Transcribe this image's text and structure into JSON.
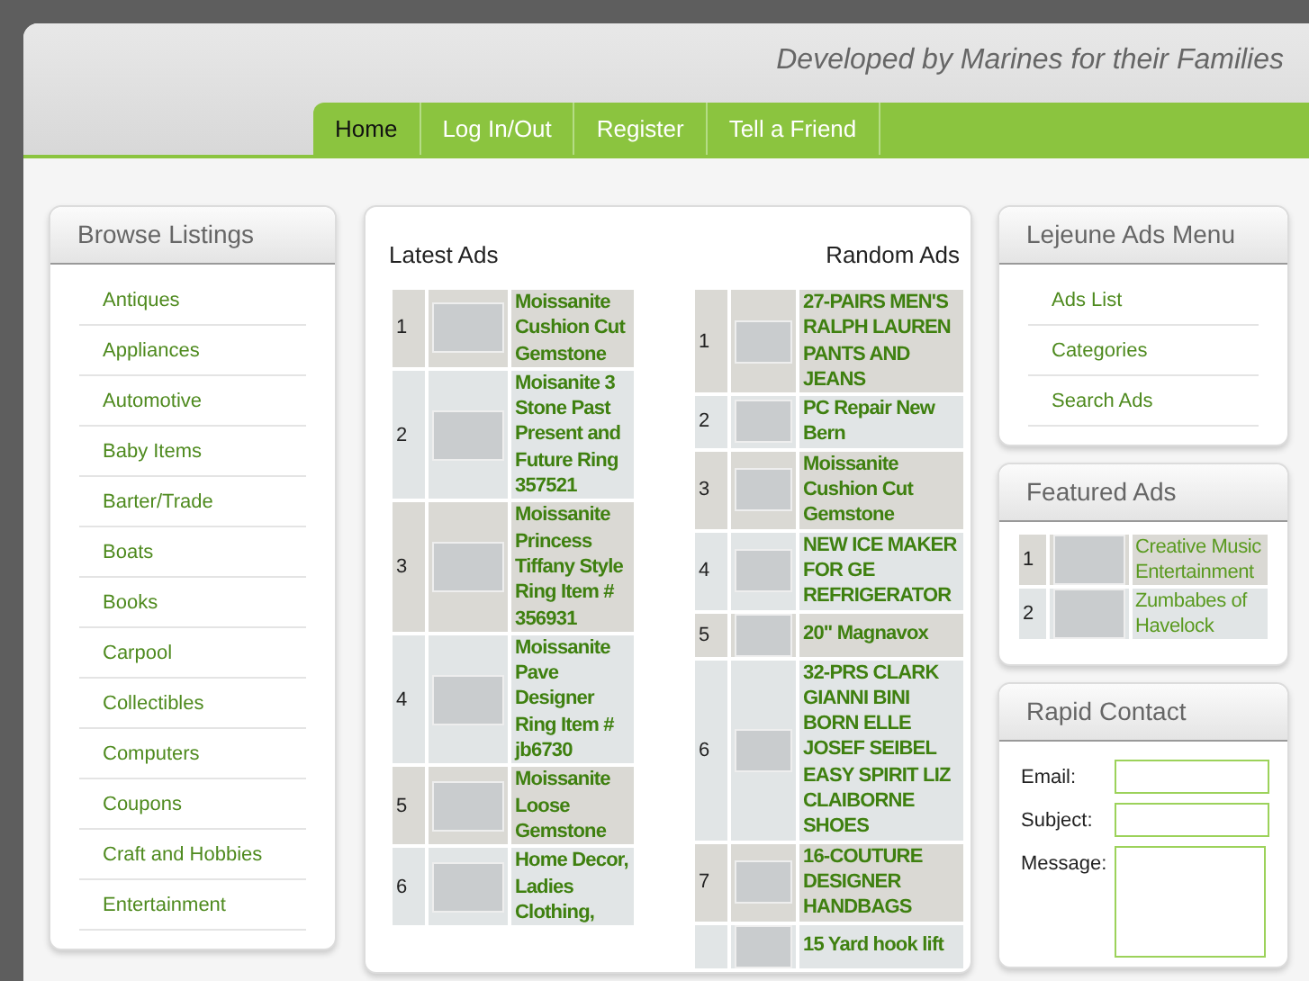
{
  "header": {
    "tagline": "Developed by Marines for their Families"
  },
  "nav": [
    {
      "label": "Home",
      "selected": true
    },
    {
      "label": "Log In/Out",
      "selected": false
    },
    {
      "label": "Register",
      "selected": false
    },
    {
      "label": "Tell a Friend",
      "selected": false
    }
  ],
  "browse_listings": {
    "title": "Browse Listings",
    "items": [
      "Antiques",
      "Appliances",
      "Automotive",
      "Baby Items",
      "Barter/Trade",
      "Boats",
      "Books",
      "Carpool",
      "Collectibles",
      "Computers",
      "Coupons",
      "Craft and Hobbies",
      "Entertainment"
    ]
  },
  "latest_ads": {
    "title": "Latest Ads",
    "rows": [
      {
        "number": "1",
        "title": "Moissanite Cushion Cut Gemstone"
      },
      {
        "number": "2",
        "title": "Moisanite 3 Stone Past Present and Future Ring 357521"
      },
      {
        "number": "3",
        "title": "Moissanite Princess Tiffany Style Ring Item # 356931"
      },
      {
        "number": "4",
        "title": "Moissanite Pave Designer Ring Item # jb6730"
      },
      {
        "number": "5",
        "title": "Moissanite Loose Gemstone"
      },
      {
        "number": "6",
        "title": "Home Decor, Ladies Clothing,"
      }
    ]
  },
  "random_ads": {
    "title": "Random Ads",
    "rows": [
      {
        "number": "1",
        "title": "27-PAIRS MEN'S RALPH LAUREN PANTS AND JEANS"
      },
      {
        "number": "2",
        "title": "PC Repair New Bern"
      },
      {
        "number": "3",
        "title": "Moissanite Cushion Cut Gemstone"
      },
      {
        "number": "4",
        "title": "NEW ICE MAKER FOR GE REFRIGERATOR"
      },
      {
        "number": "5",
        "title": "20\" Magnavox"
      },
      {
        "number": "6",
        "title": "32-PRS CLARK GIANNI BINI BORN ELLE JOSEF SEIBEL EASY SPIRIT LIZ CLAIBORNE SHOES"
      },
      {
        "number": "7",
        "title": "16-COUTURE DESIGNER HANDBAGS"
      },
      {
        "title": "15 Yard hook lift"
      }
    ]
  },
  "ads_menu": {
    "title": "Lejeune Ads Menu",
    "items": [
      "Ads List",
      "Categories",
      "Search Ads"
    ]
  },
  "featured_ads": {
    "title": "Featured Ads",
    "rows": [
      {
        "number": "1",
        "title": "Creative Music Entertainment"
      },
      {
        "number": "2",
        "title": "Zumbabes of Havelock"
      }
    ]
  },
  "rapid_contact": {
    "title": "Rapid Contact",
    "fields": [
      {
        "label": "Email:",
        "kind": "line"
      },
      {
        "label": "Subject:",
        "kind": "line"
      },
      {
        "label": "Message:",
        "kind": "area"
      }
    ]
  }
}
